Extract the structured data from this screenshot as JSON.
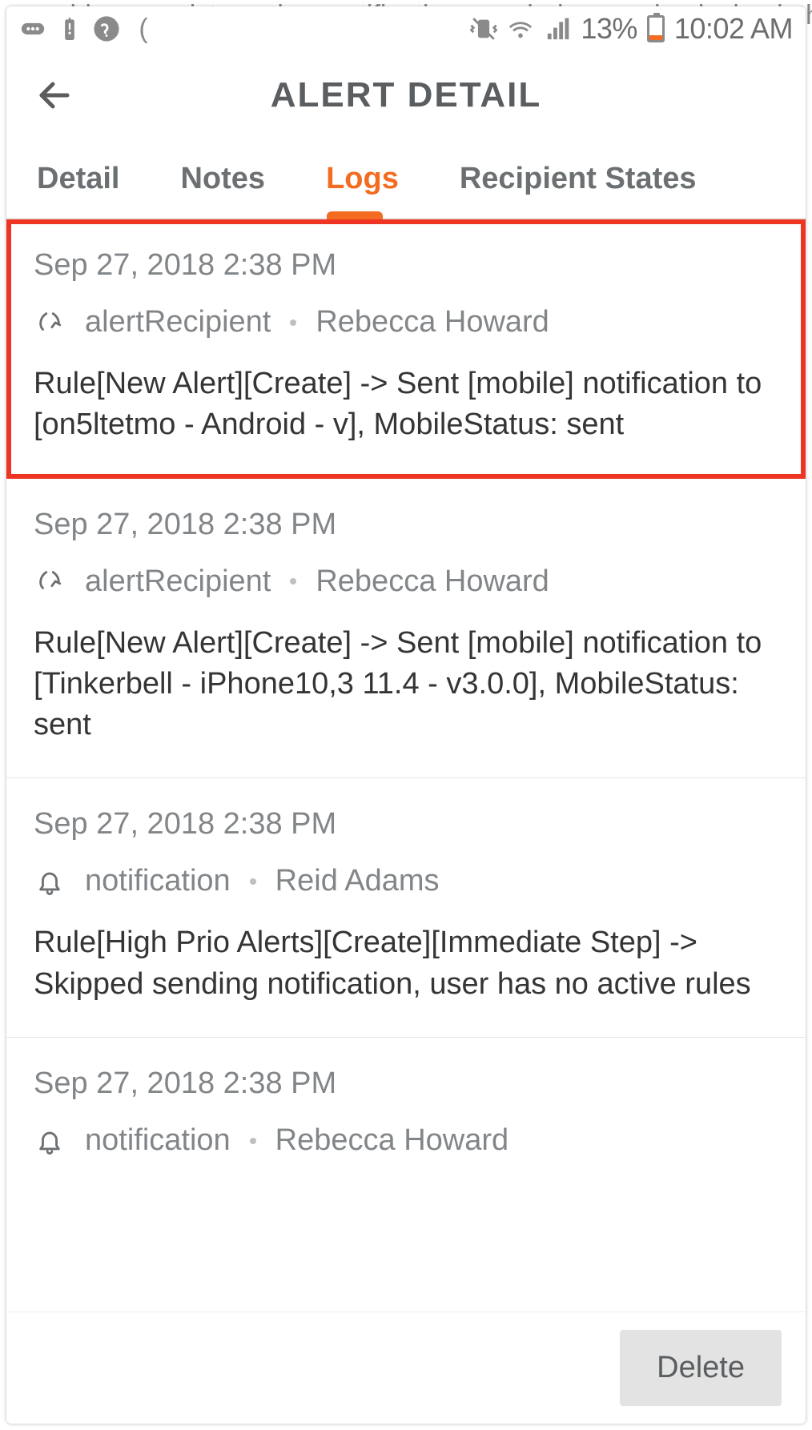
{
  "background_hint": "e problem persists and no notifications are being received, check the alert logs. T",
  "status_bar": {
    "battery_pct": "13%",
    "time": "10:02 AM"
  },
  "header": {
    "title": "ALERT DETAIL"
  },
  "tabs": {
    "items": [
      "Detail",
      "Notes",
      "Logs",
      "Recipient States"
    ],
    "active": "Logs"
  },
  "logs": [
    {
      "highlighted": true,
      "timestamp": "Sep 27, 2018 2:38 PM",
      "icon": "recipient",
      "type": "alertRecipient",
      "user": "Rebecca Howard",
      "message": "Rule[New Alert][Create] -> Sent [mobile] notification to [on5ltetmo - Android  - v], MobileStatus: sent"
    },
    {
      "highlighted": false,
      "timestamp": "Sep 27, 2018 2:38 PM",
      "icon": "recipient",
      "type": "alertRecipient",
      "user": "Rebecca Howard",
      "message": "Rule[New Alert][Create] -> Sent [mobile] notification to [Tinkerbell - iPhone10,3 11.4 - v3.0.0], MobileStatus: sent"
    },
    {
      "highlighted": false,
      "timestamp": "Sep 27, 2018 2:38 PM",
      "icon": "bell",
      "type": "notification",
      "user": "Reid Adams",
      "message": "Rule[High Prio Alerts][Create][Immediate Step] -> Skipped sending notification, user has no active rules"
    },
    {
      "highlighted": false,
      "timestamp": "Sep 27, 2018 2:38 PM",
      "icon": "bell",
      "type": "notification",
      "user": "Rebecca Howard",
      "message": ""
    }
  ],
  "footer": {
    "delete_label": "Delete"
  }
}
